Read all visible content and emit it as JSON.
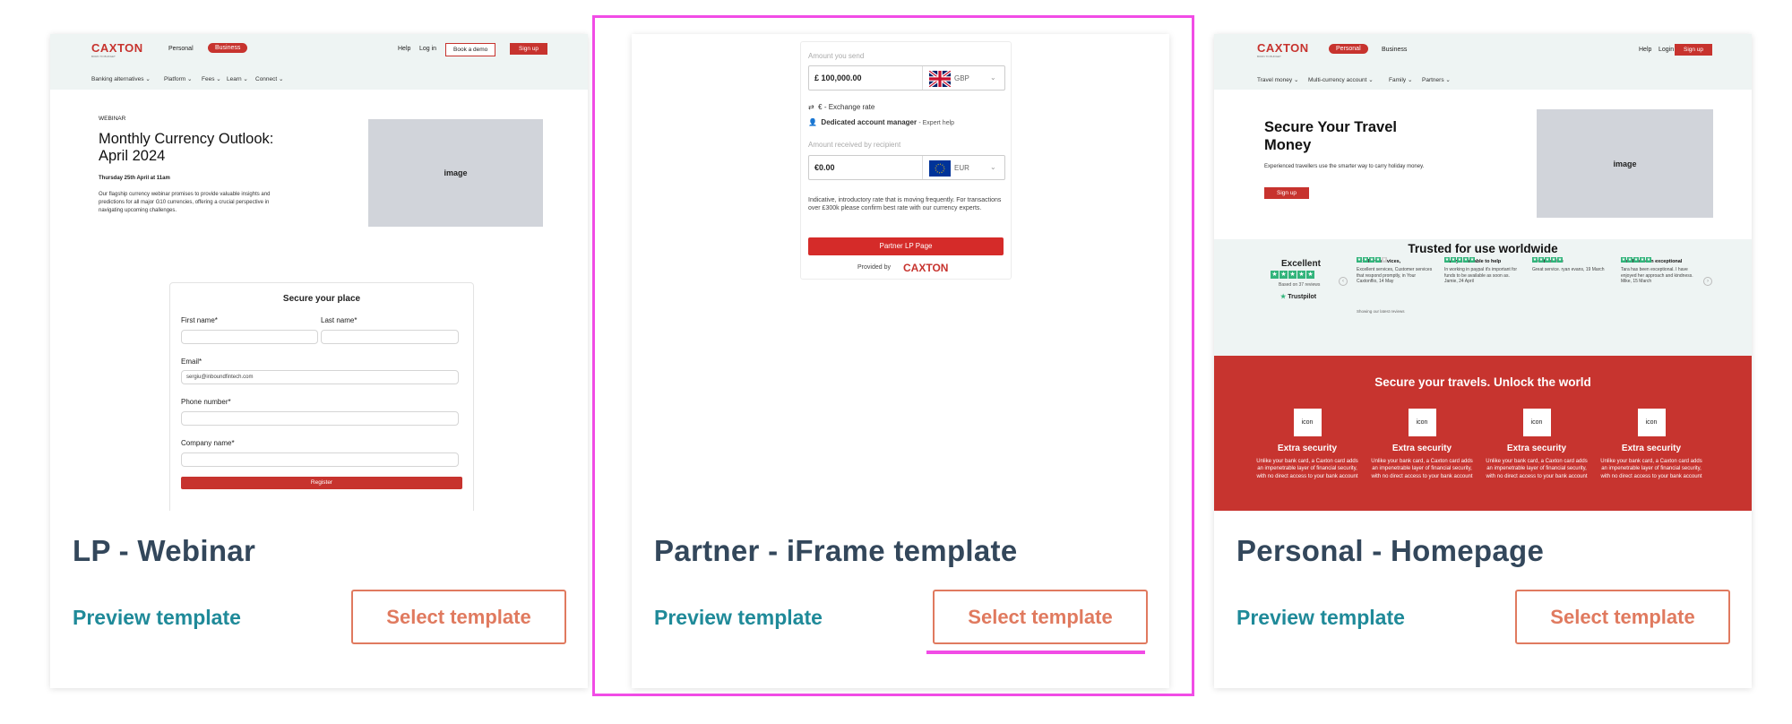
{
  "cards": [
    {
      "title": "LP - Webinar",
      "preview_label": "Preview template",
      "select_label": "Select template",
      "site": {
        "logo": "CAXTON",
        "logo_sub": "BORN TO BUDGET",
        "nav_personal": "Personal",
        "nav_business": "Business",
        "help": "Help",
        "login": "Log in",
        "book_demo": "Book a demo",
        "signup": "Sign up",
        "subnav": [
          "Banking alternatives ⌄",
          "Platform ⌄",
          "Fees ⌄",
          "Learn ⌄",
          "Connect ⌄"
        ],
        "eyebrow": "WEBINAR",
        "headline": "Monthly Currency Outlook: April 2024",
        "date": "Thursday 25th April at 11am",
        "description": "Our flagship currency webinar promises to provide valuable insights and predictions for all major G10 currencies, offering a crucial perspective in navigating upcoming challenges.",
        "image_label": "image",
        "form": {
          "title": "Secure your place",
          "first_name": "First name*",
          "last_name": "Last name*",
          "email": "Email*",
          "email_value": "sergiu@inboundfintech.com",
          "phone": "Phone number*",
          "company": "Company name*",
          "register": "Register"
        }
      }
    },
    {
      "title": "Partner - iFrame template",
      "preview_label": "Preview template",
      "select_label": "Select template",
      "widget": {
        "send_label": "Amount you send",
        "send_value": "£ 100,000.00",
        "send_currency": "GBP",
        "rate_label": "€ - Exchange rate",
        "manager_label": "Dedicated account manager",
        "manager_suffix": "- Expert help",
        "receive_label": "Amount received by recipient",
        "receive_value": "€0.00",
        "receive_currency": "EUR",
        "disclaimer": "Indicative, introductory rate that is moving frequently. For transactions over £300k please confirm best rate with our currency experts.",
        "cta": "Partner LP Page",
        "provided_by": "Provided by",
        "brand": "CAXTON"
      }
    },
    {
      "title": "Personal - Homepage",
      "preview_label": "Preview template",
      "select_label": "Select template",
      "site": {
        "logo": "CAXTON",
        "logo_sub": "BORN TO BUDGET",
        "nav_personal": "Personal",
        "nav_business": "Business",
        "help": "Help",
        "login": "Login",
        "signup": "Sign up",
        "subnav": [
          "Travel money ⌄",
          "Multi-currency account ⌄",
          "Family ⌄",
          "Partners ⌄"
        ],
        "headline": "Secure Your Travel Money",
        "sub": "Experienced travellers use the smarter way to carry holiday money.",
        "cta": "Sign up",
        "image_label": "image",
        "trust_title": "Trusted for use worldwide",
        "excellent": "Excellent",
        "based_on": "Based on 37 reviews",
        "trustpilot": "Trustpilot",
        "showing": "Showing our latest reviews",
        "reviews": [
          {
            "title": "Excellent services,",
            "body": "Excellent services, Customer services that respond promptly, in Your Caxtonflio, 14 May"
          },
          {
            "title": "Always available to help",
            "body": "In working in paypal it's important for funds to be available as soon as. Jamie, 24 April"
          },
          {
            "title": "Great service",
            "body": "Great service. ryan evans, 19 March"
          },
          {
            "title": "Tara has been exceptional",
            "body": "Tara has been exceptional. I have enjoyed her approach and kindness. Mike, 15 March"
          }
        ],
        "band_title": "Secure your travels. Unlock the world",
        "features": [
          {
            "icon": "icon",
            "title": "Extra security",
            "body": "Unlike your bank card, a Caxton card adds an impenetrable layer of financial security, with no direct access to your bank account"
          },
          {
            "icon": "icon",
            "title": "Extra security",
            "body": "Unlike your bank card, a Caxton card adds an impenetrable layer of financial security, with no direct access to your bank account"
          },
          {
            "icon": "icon",
            "title": "Extra security",
            "body": "Unlike your bank card, a Caxton card adds an impenetrable layer of financial security, with no direct access to your bank account"
          },
          {
            "icon": "icon",
            "title": "Extra security",
            "body": "Unlike your bank card, a Caxton card adds an impenetrable layer of financial security, with no direct access to your bank account"
          }
        ]
      }
    }
  ],
  "colors": {
    "brand_red": "#c7332e",
    "title": "#33475b",
    "preview_teal": "#1f8a99",
    "select_orange": "#e07a5f",
    "highlight_pink": "#f14ce6",
    "trustpilot_green": "#32b47b"
  }
}
